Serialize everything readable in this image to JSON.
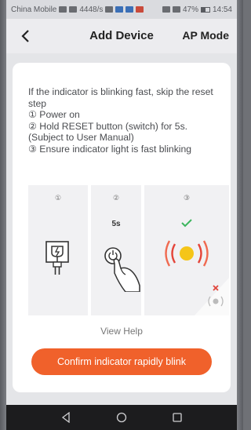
{
  "status_bar": {
    "carrier": "China Mobile",
    "net_speed": "4448/s",
    "battery": "47%",
    "time": "14:54"
  },
  "header": {
    "back_icon": "chevron-left-icon",
    "title": "Add Device",
    "mode_label": "AP Mode"
  },
  "instructions": {
    "intro": "If the indicator is blinking fast, skip the reset step",
    "step1": "① Power on",
    "step2": "② Hold RESET button (switch) for 5s. (Subject to User Manual)",
    "step3": "③ Ensure indicator light is fast blinking"
  },
  "illustration": {
    "panel1_number": "①",
    "panel2_number": "②",
    "panel2_duration": "5s",
    "panel3_number": "③",
    "panel1_icon": "power-plug-icon",
    "panel2_icon": "finger-press-button-icon",
    "panel3_icon": "blinking-light-icon",
    "check_icon": "checkmark-icon",
    "wrong_icon": "slow-blink-x-icon",
    "light_color": "#f5c518",
    "check_color": "#3cb55d",
    "wrong_color": "#e0443a"
  },
  "view_help": "View Help",
  "confirm_button": "Confirm indicator rapidly blink",
  "accent_color": "#f0612b",
  "nav": {
    "back": "nav-back-icon",
    "home": "nav-home-icon",
    "recents": "nav-recents-icon"
  }
}
